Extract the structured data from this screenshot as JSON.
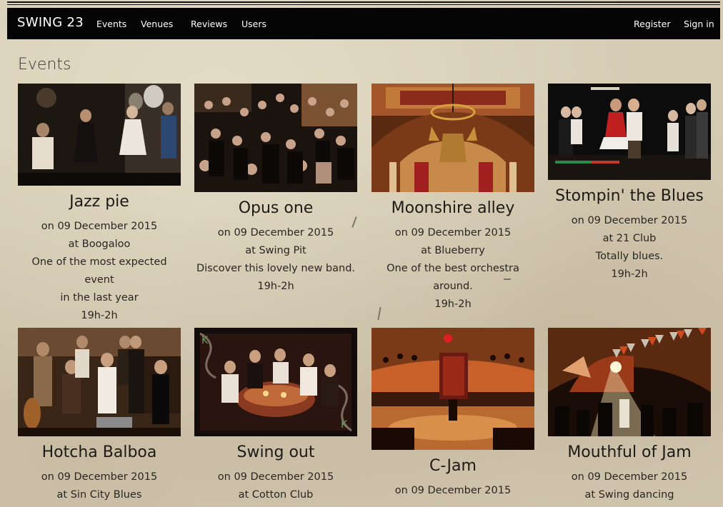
{
  "navbar": {
    "brand": "SWING 23",
    "items": [
      "Events",
      "Venues",
      "Reviews",
      "Users"
    ],
    "register": "Register",
    "sign_in": "Sign in"
  },
  "page": {
    "title": "Events"
  },
  "events": [
    {
      "title": "Jazz pie",
      "date": "on 09 December 2015",
      "venue": "at Boogaloo",
      "desc1": "One of the most expected event",
      "desc2": "in the last year",
      "time": "19h-2h",
      "image": "dancers-photo"
    },
    {
      "title": "Opus one",
      "date": "on 09 December 2015",
      "venue": "at Swing Pit",
      "desc1": "Discover this lovely new band.",
      "desc2": "",
      "time": "19h-2h",
      "image": "crowd-photo"
    },
    {
      "title": "Moonshire alley",
      "date": "on 09 December 2015",
      "venue": "at Blueberry",
      "desc1": "One of the best orchestra",
      "desc2": "around.",
      "time": "19h-2h",
      "image": "ballroom-ceiling-photo"
    },
    {
      "title": "Stompin' the Blues",
      "date": "on 09 December 2015",
      "venue": "at 21 Club",
      "desc1": "Totally blues.",
      "desc2": "",
      "time": "19h-2h",
      "image": "dance-floor-photo"
    },
    {
      "title": "Hotcha Balboa",
      "date": "on 09 December 2015",
      "venue": "at Sin City Blues",
      "image": "band-photo"
    },
    {
      "title": "Swing out",
      "date": "on 09 December 2015",
      "venue": "at Cotton Club",
      "image": "table-party-photo"
    },
    {
      "title": "C-Jam",
      "date": "on 09 December 2015",
      "image": "dance-hall-photo"
    },
    {
      "title": "Mouthful of Jam",
      "date": "on 09 December 2015",
      "venue": "at Swing dancing",
      "image": "festival-tent-photo"
    }
  ]
}
